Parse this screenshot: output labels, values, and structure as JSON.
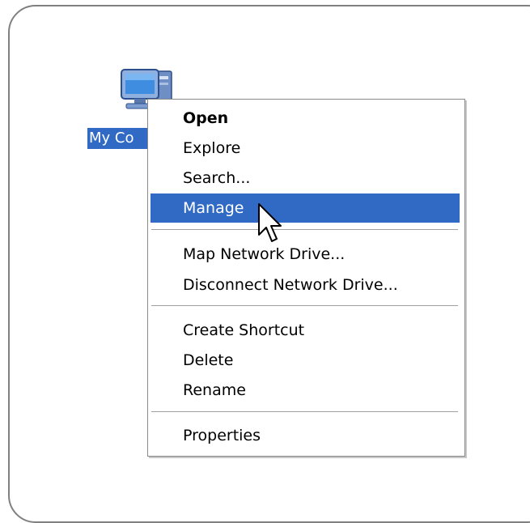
{
  "desktop": {
    "icon_label": "My Co",
    "icon_name": "my-computer-icon"
  },
  "context_menu": {
    "items": [
      {
        "label": "Open",
        "bold": true
      },
      {
        "label": "Explore"
      },
      {
        "label": "Search..."
      },
      {
        "label": "Manage",
        "highlighted": true
      },
      {
        "label": "Map Network Drive..."
      },
      {
        "label": "Disconnect Network Drive..."
      },
      {
        "label": "Create Shortcut"
      },
      {
        "label": "Delete"
      },
      {
        "label": "Rename"
      },
      {
        "label": "Properties"
      }
    ]
  },
  "colors": {
    "highlight": "#316ac5",
    "frame_border": "#808080"
  },
  "cursor": "arrow-pointer-icon"
}
